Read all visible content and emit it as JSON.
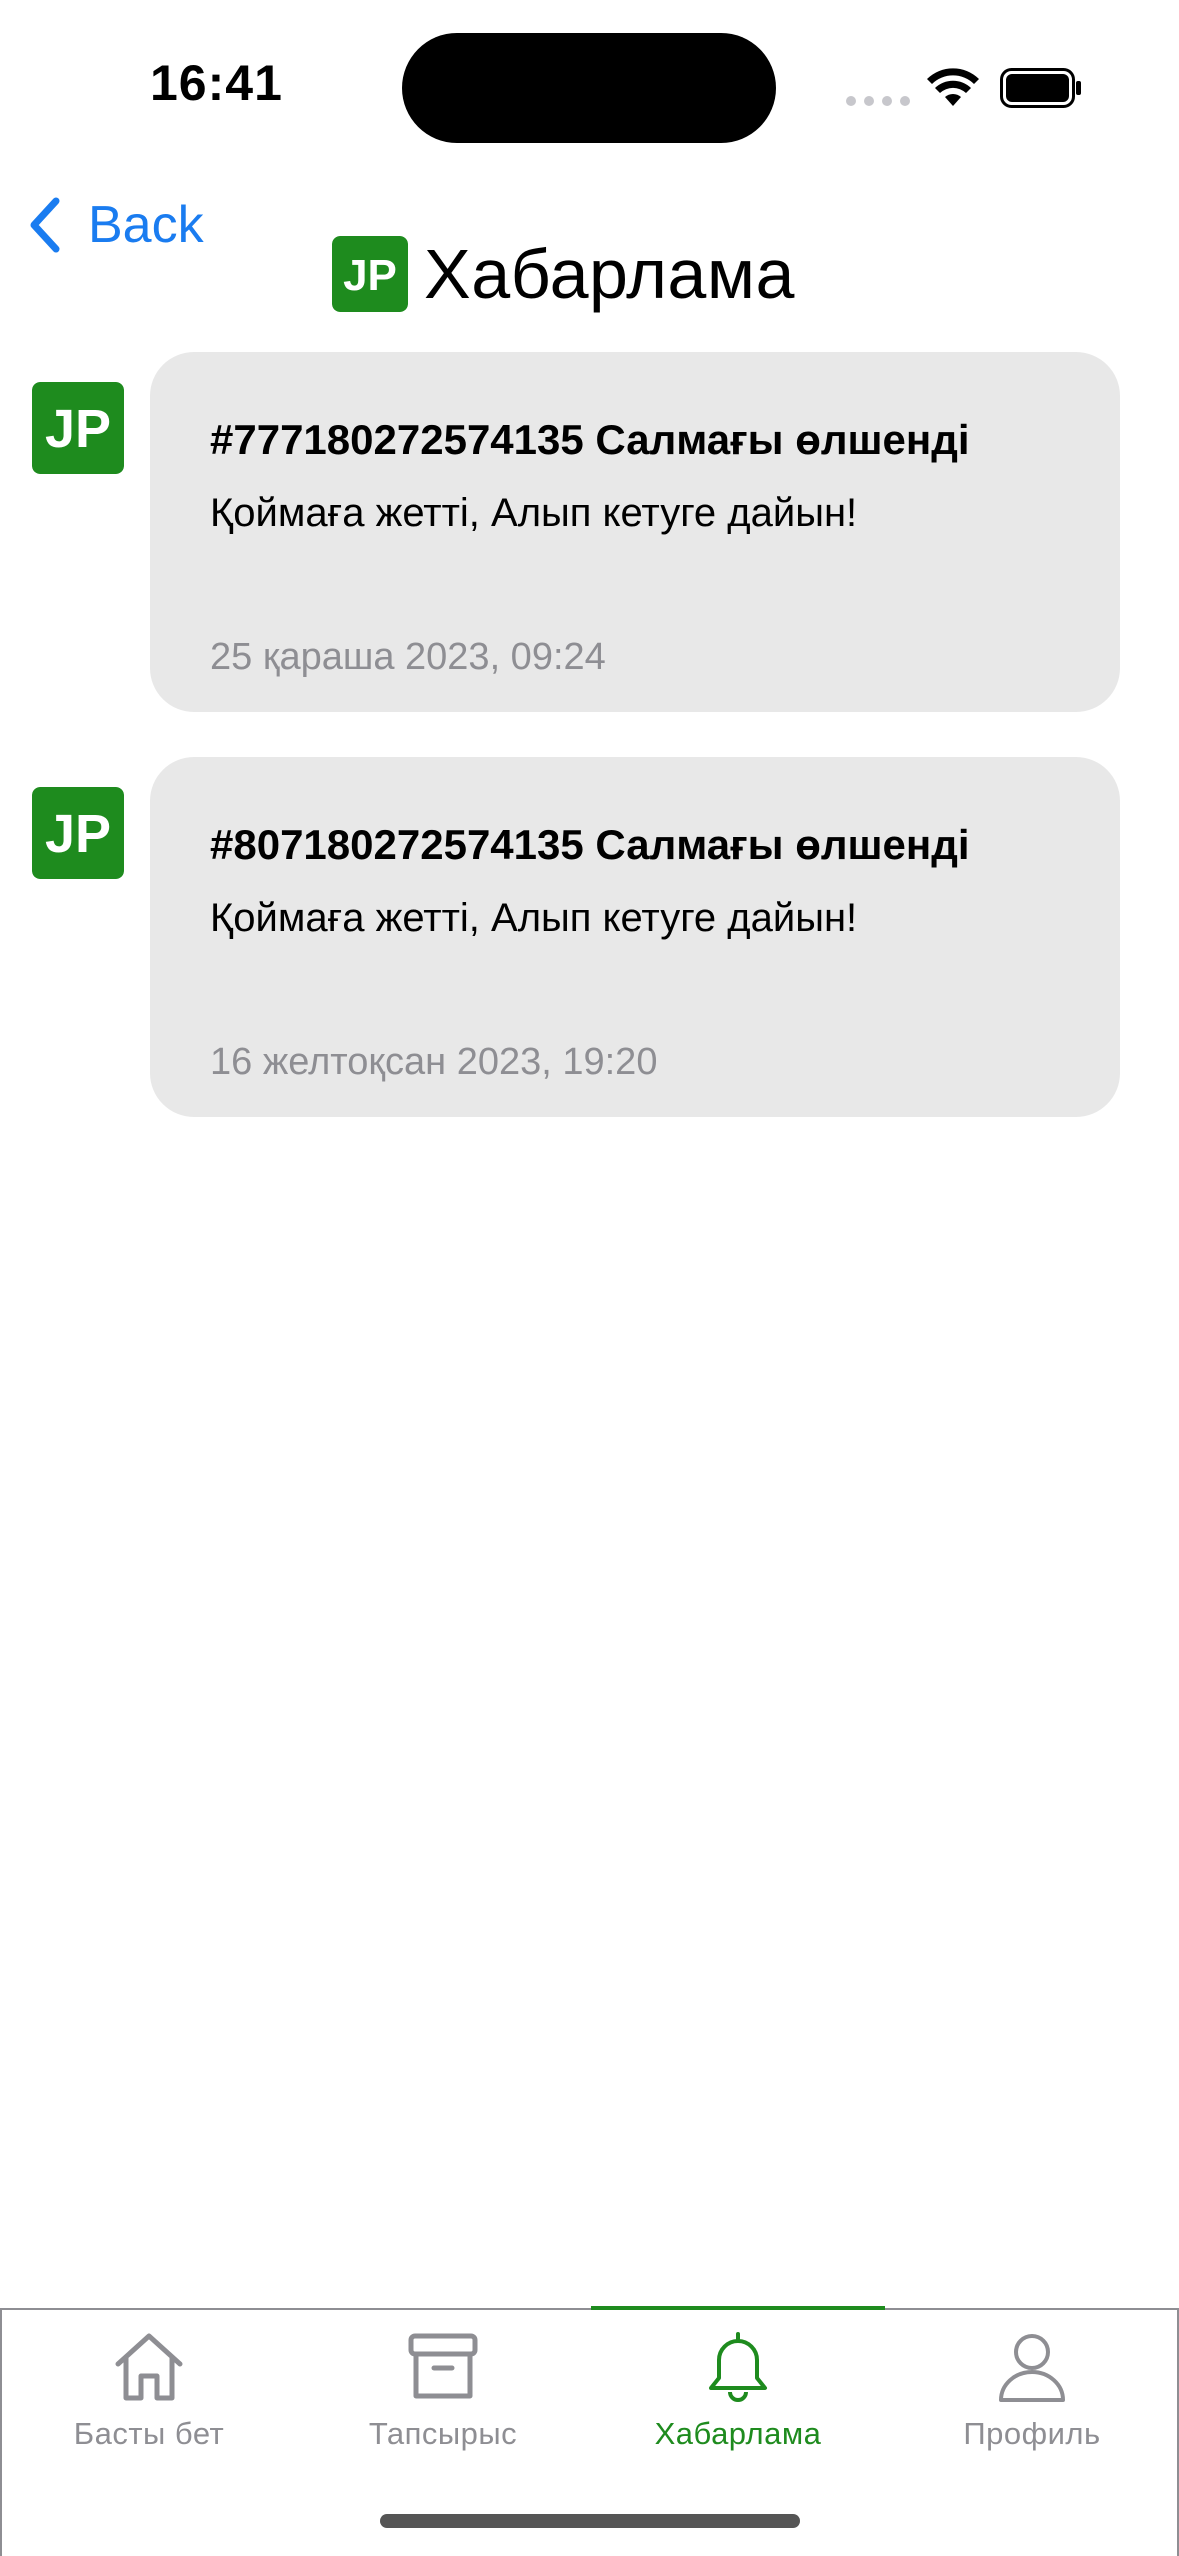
{
  "status_bar": {
    "time": "16:41"
  },
  "nav": {
    "back_label": "Back",
    "title": "Хабарлама",
    "logo_text": "JP"
  },
  "messages": [
    {
      "avatar_text": "JP",
      "title": "#777180272574135 Салмағы өлшенді",
      "body": "Қоймаға жетті, Алып кетуге дайын!",
      "date": "25 қараша 2023, 09:24"
    },
    {
      "avatar_text": "JP",
      "title": "#807180272574135 Салмағы өлшенді",
      "body": "Қоймаға жетті, Алып кетуге дайын!",
      "date": "16 желтоқсан 2023, 19:20"
    }
  ],
  "tabs": [
    {
      "label": "Басты бет",
      "icon": "home-icon",
      "active": false
    },
    {
      "label": "Тапсырыс",
      "icon": "archive-box-icon",
      "active": false
    },
    {
      "label": "Хабарлама",
      "icon": "bell-icon",
      "active": true
    },
    {
      "label": "Профиль",
      "icon": "person-icon",
      "active": false
    }
  ],
  "colors": {
    "accent_green": "#1e8b1e",
    "back_blue": "#1a7cf0",
    "bubble_gray": "#e8e8e8",
    "date_gray": "#8e8e93"
  }
}
